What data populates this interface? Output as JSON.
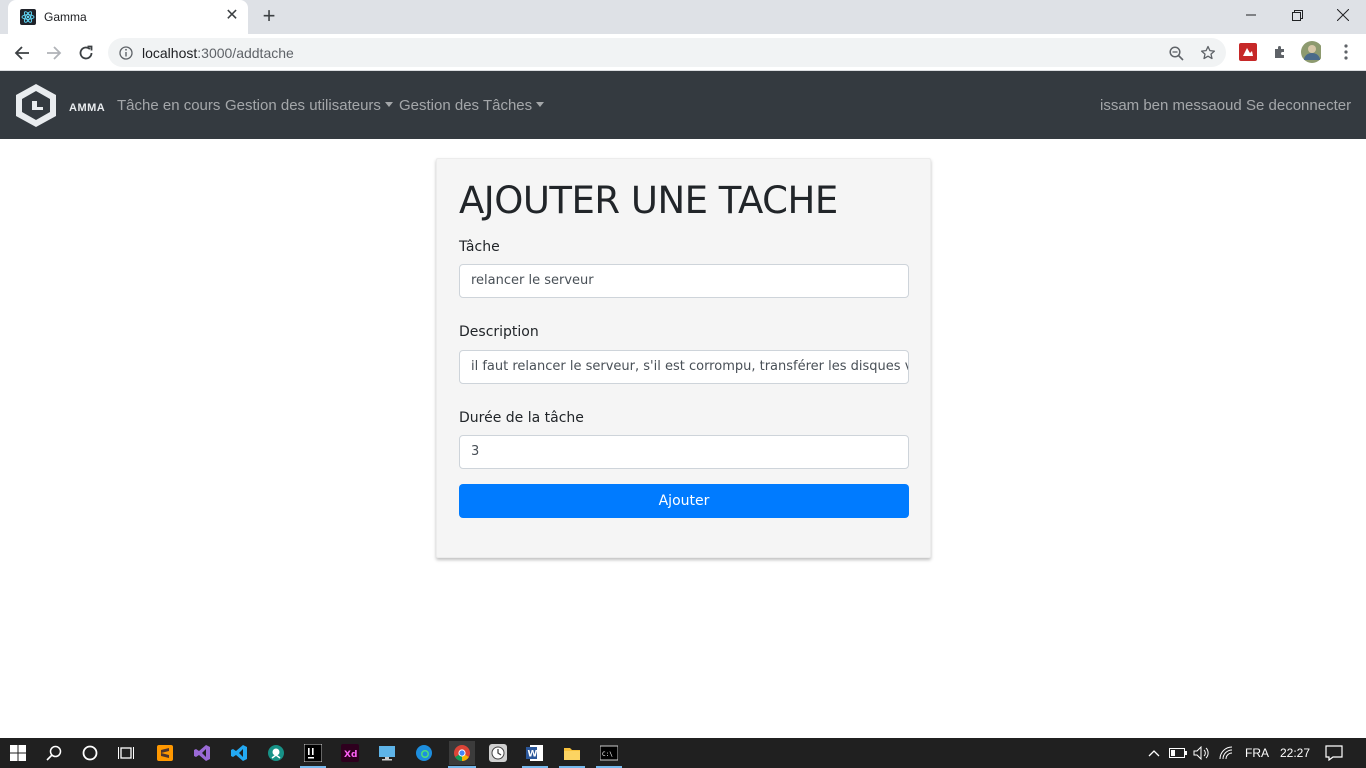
{
  "browser": {
    "tab_title": "Gamma",
    "url_host": "localhost",
    "url_rest": ":3000/addtache"
  },
  "navbar": {
    "brand": "AMMA",
    "links": [
      "Tâche en cours",
      "Gestion des utilisateurs",
      "Gestion des Tâches"
    ],
    "user": "issam ben messaoud",
    "logout": "Se deconnecter"
  },
  "form": {
    "title": "AJOUTER UNE TACHE",
    "task_label": "Tâche",
    "task_value": "relancer le serveur",
    "description_label": "Description",
    "description_value": "il faut relancer le serveur, s'il est corrompu, transférer les disques ve",
    "duration_label": "Durée de la tâche",
    "duration_value": "3",
    "submit_label": "Ajouter"
  },
  "taskbar": {
    "language": "FRA",
    "time": "22:27"
  },
  "colors": {
    "navbar": "#343a40",
    "primary": "#007bff",
    "card": "#f5f5f5"
  }
}
